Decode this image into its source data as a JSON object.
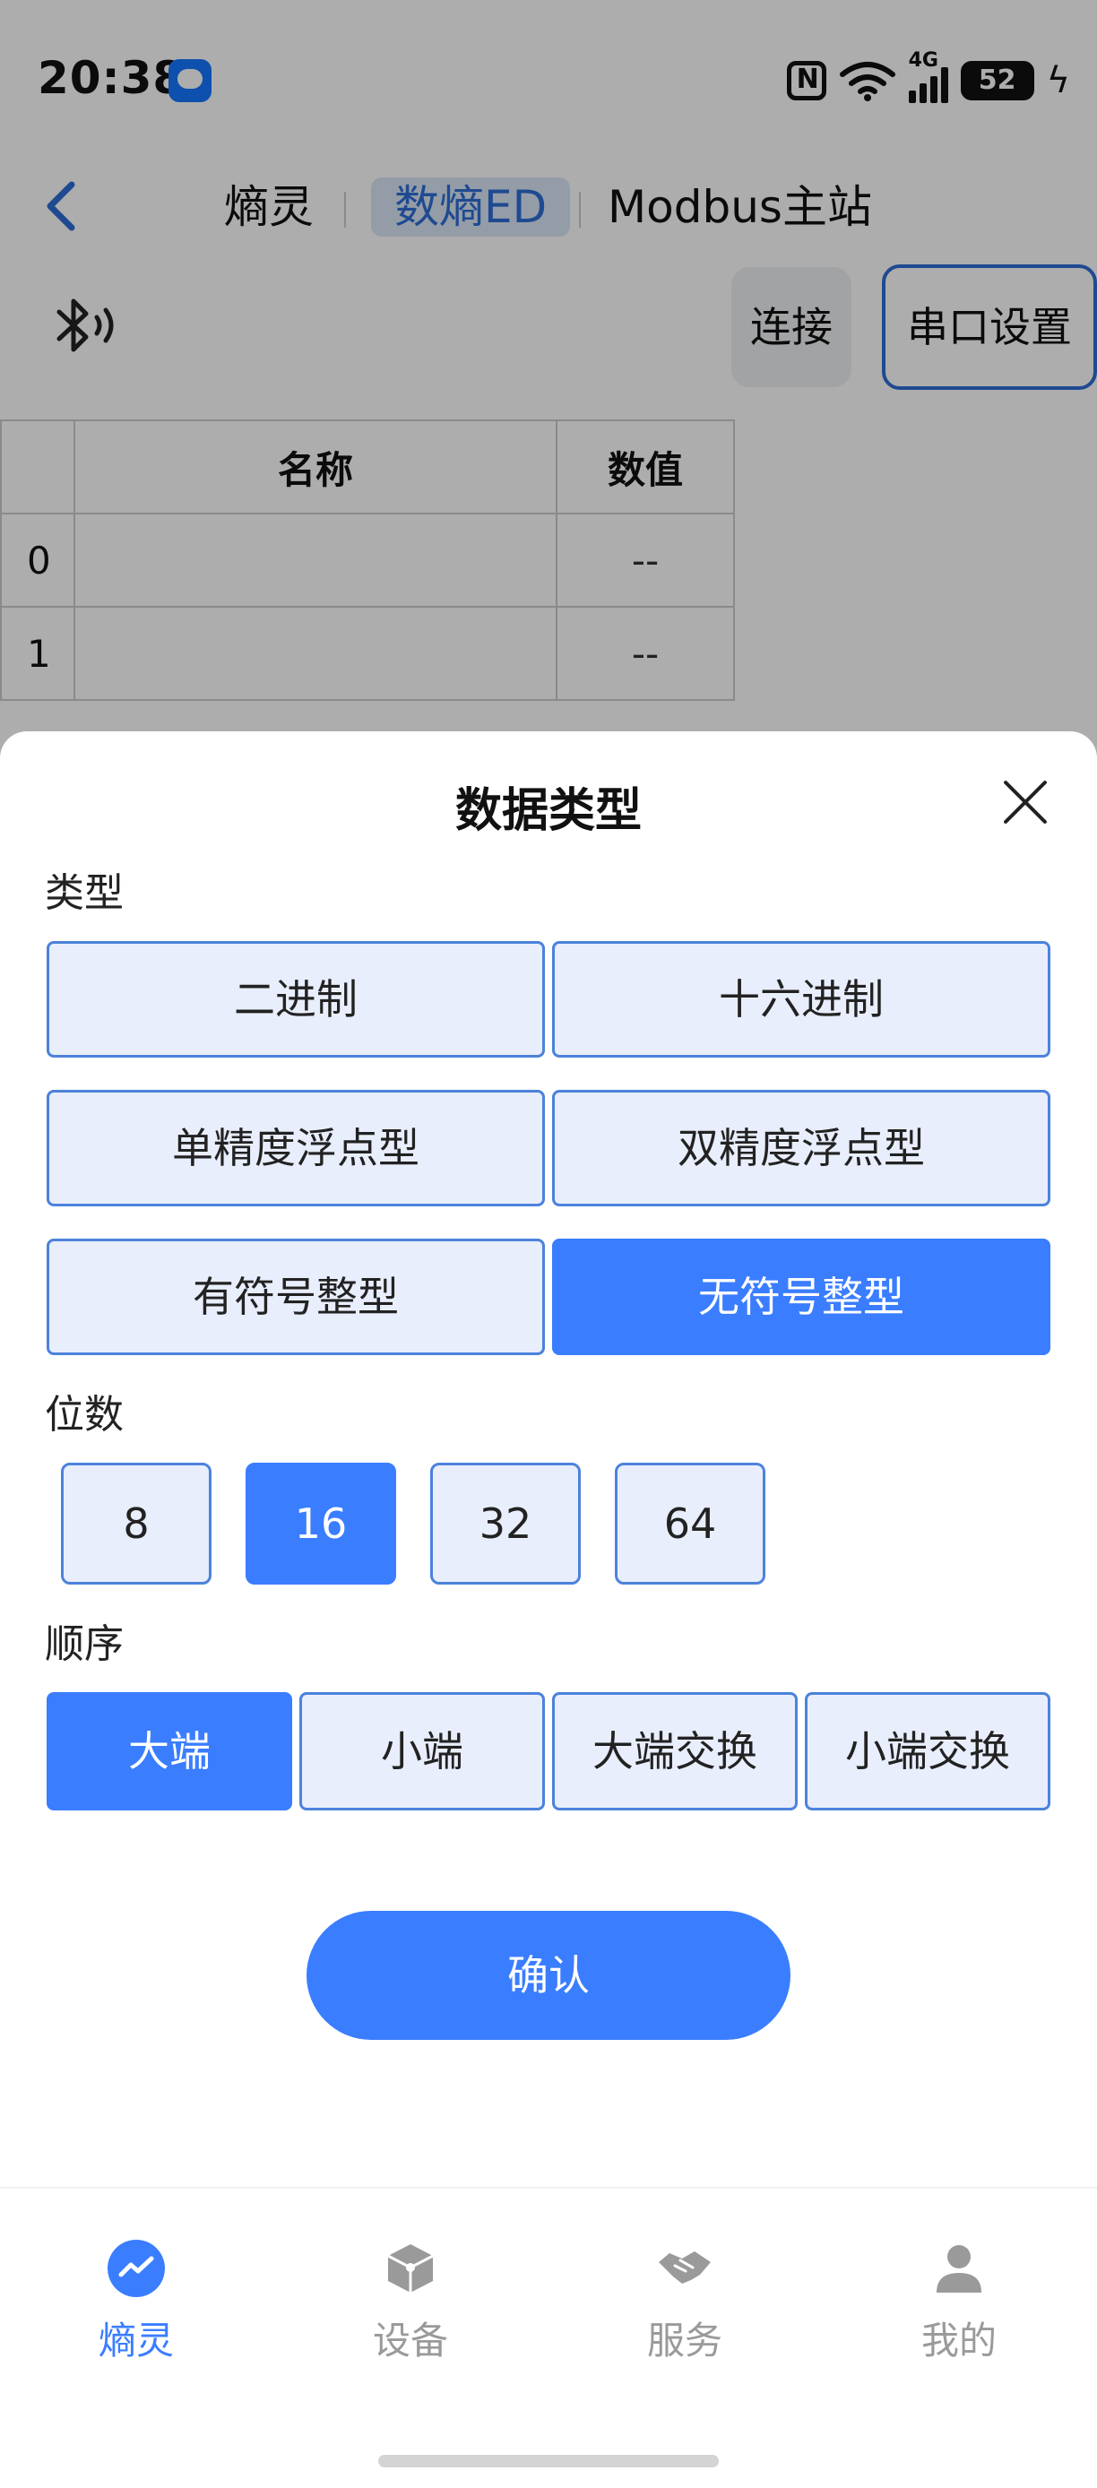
{
  "status_bar": {
    "time": "20:38",
    "network": "4G",
    "battery": "52"
  },
  "top_nav": {
    "tabs": [
      {
        "label": "熵灵"
      },
      {
        "label": "数熵ED"
      },
      {
        "label": "Modbus主站"
      }
    ],
    "active_tab": "数熵ED"
  },
  "toolbar": {
    "connect_label": "连接",
    "serial_settings_label": "串口设置"
  },
  "table": {
    "headers": [
      "",
      "名称",
      "数值"
    ],
    "rows": [
      {
        "index": "0",
        "name": "",
        "value": "--"
      },
      {
        "index": "1",
        "name": "",
        "value": "--"
      }
    ]
  },
  "sheet": {
    "title": "数据类型",
    "type_label": "类型",
    "type_options": [
      "二进制",
      "十六进制",
      "单精度浮点型",
      "双精度浮点型",
      "有符号整型",
      "无符号整型"
    ],
    "type_selected": "无符号整型",
    "bits_label": "位数",
    "bits_options": [
      "8",
      "16",
      "32",
      "64"
    ],
    "bits_selected": "16",
    "order_label": "顺序",
    "order_options": [
      "大端",
      "小端",
      "大端交换",
      "小端交换"
    ],
    "order_selected": "大端",
    "confirm_label": "确认"
  },
  "tabbar": {
    "items": [
      {
        "label": "熵灵",
        "icon": "trend-icon"
      },
      {
        "label": "设备",
        "icon": "cube-icon"
      },
      {
        "label": "服务",
        "icon": "handshake-icon"
      },
      {
        "label": "我的",
        "icon": "person-icon"
      }
    ],
    "active": "熵灵"
  },
  "colors": {
    "accent": "#3a7dff",
    "option_bg": "#e9eefc",
    "option_border": "#4c82dc",
    "nav_active_bg": "#dbe7f7"
  }
}
